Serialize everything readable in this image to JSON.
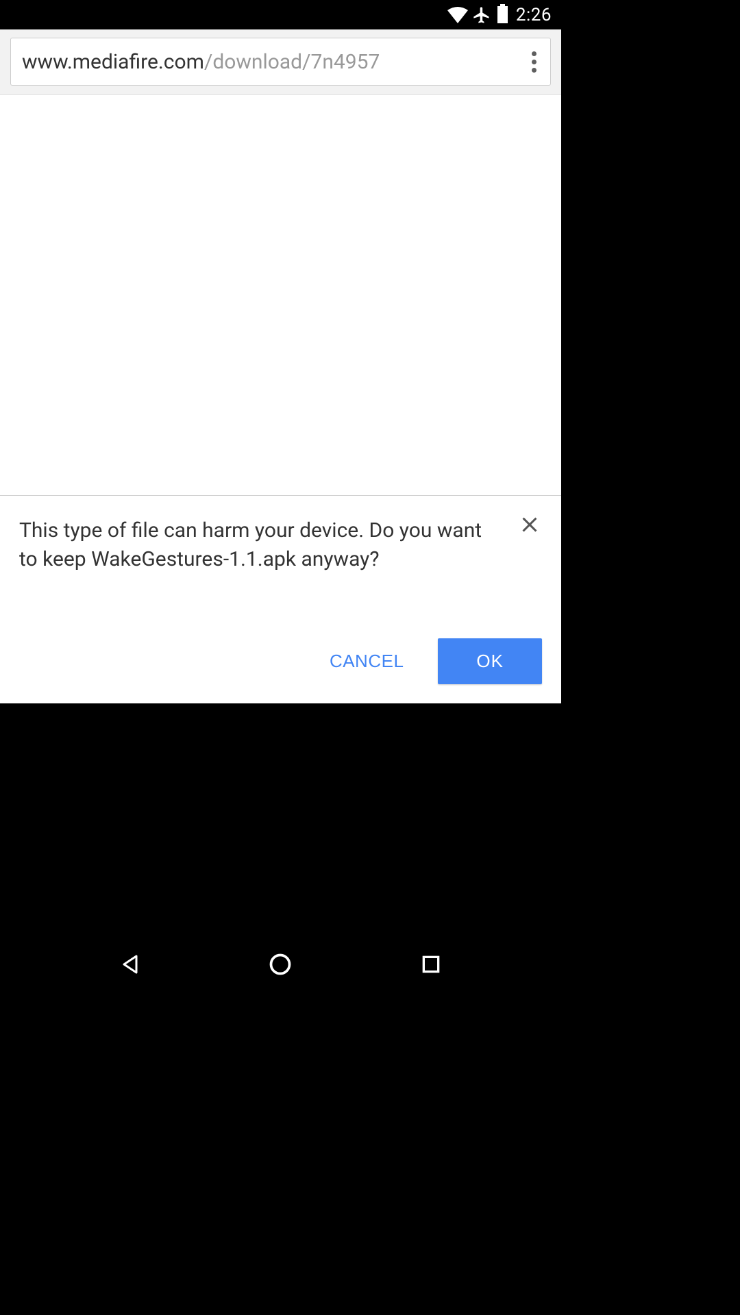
{
  "status_bar": {
    "time": "2:26",
    "icons": {
      "wifi": "wifi-icon",
      "airplane": "airplane-icon",
      "battery": "battery-icon"
    }
  },
  "browser": {
    "url_domain": "www.mediafire.com",
    "url_path": "/download/7n4957"
  },
  "dialog": {
    "message": "This type of file can harm your device. Do you want to keep WakeGestures-1.1.apk anyway?",
    "cancel_label": "CANCEL",
    "ok_label": "OK"
  },
  "nav": {
    "back": "back",
    "home": "home",
    "recent": "recent"
  }
}
